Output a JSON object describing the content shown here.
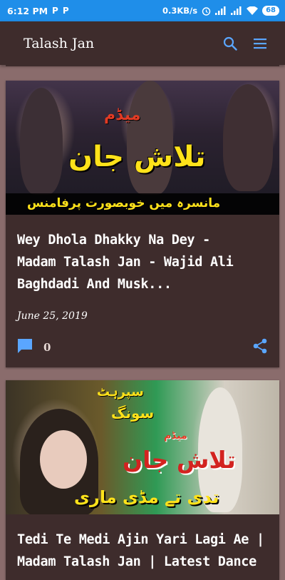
{
  "status_bar": {
    "time": "6:12 PM",
    "indicators": [
      "P",
      "P"
    ],
    "net_speed": "0.3KB/s",
    "battery": "68",
    "icons": [
      "alarm-icon",
      "signal-icon",
      "signal-icon",
      "wifi-icon",
      "battery-icon"
    ]
  },
  "app_bar": {
    "title": "Talash Jan",
    "icons": [
      "search-icon",
      "menu-icon"
    ]
  },
  "posts": [
    {
      "thumbnail": {
        "overlay_title_small": "میڈم",
        "overlay_title_big": "تلاش جان",
        "overlay_subtitle": "مانسرہ میں خوبصورت پرفامنس"
      },
      "title_lines": [
        "Wey Dhola Dhakky Na Dey -",
        "Madam Talash Jan - Wajid Ali",
        "Baghdadi And Musk..."
      ],
      "date": "June 25, 2019",
      "comment_count": "0"
    },
    {
      "thumbnail": {
        "overlay_top1": "سپرہٹ",
        "overlay_top2": "سونگ",
        "overlay_title_small": "میڈم",
        "overlay_title_big": "تلاش جان",
        "overlay_bottom": "تدی تے مڈی ماری"
      },
      "title_lines": [
        "Tedi Te Medi Ajin Yari Lagi Ae |",
        "Madam Talash Jan | Latest Dance"
      ]
    }
  ],
  "colors": {
    "status_bar": "#1f8ee9",
    "app_bar": "#3e2c2c",
    "page_background": "#8a6c6c",
    "card": "#3e2c2c",
    "accent_icon": "#5aa6ff"
  }
}
